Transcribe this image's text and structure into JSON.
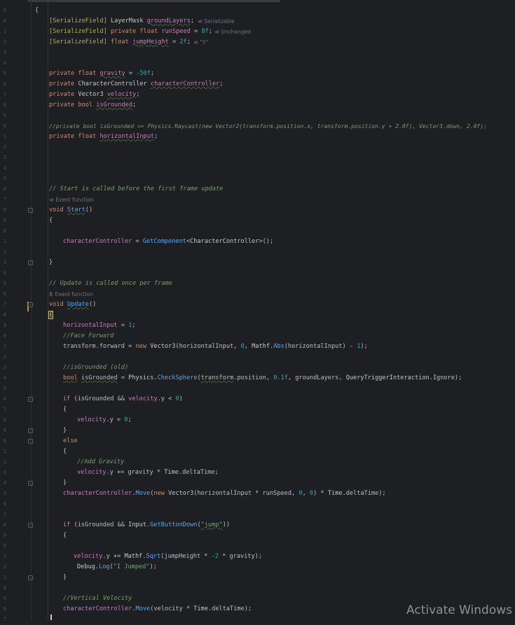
{
  "editor": {
    "gutter_numbers": [
      "9",
      "0",
      "1",
      "2",
      "3",
      "4",
      "5",
      "6",
      "7",
      "8",
      "9",
      "0",
      "1",
      "2",
      "3",
      "4",
      "5",
      "6",
      "7",
      "8",
      "9",
      "0",
      "1",
      "2",
      "3",
      "4",
      "5",
      "6",
      "7",
      "8",
      "9",
      "0",
      "1",
      "2",
      "3",
      "4",
      "5",
      "6",
      "7",
      "8",
      "9",
      "0",
      "1",
      "2",
      "3",
      "4",
      "5",
      "6",
      "7",
      "8",
      "9",
      "0",
      "1",
      "2",
      "3",
      "4",
      "5",
      "6",
      "7"
    ],
    "code": {
      "l1_brace": "{",
      "l2_attr": "[SerializeField]",
      "l2_type": "LayerMask",
      "l2_name": "groundLayers",
      "l2_end": ";",
      "l2_hint": "Serializable",
      "l3_attr": "[SerializeField]",
      "l3_kw": "private float",
      "l3_name": "runSpeed",
      "l3_eq": " = ",
      "l3_val": "8f",
      "l3_end": ";",
      "l3_hint": "Unchanged",
      "l4_attr": "[SerializeField]",
      "l4_kw": "float",
      "l4_name": "jumpHeight",
      "l4_eq": " = ",
      "l4_val": "2f",
      "l4_end": ";",
      "l4_hint": "\"5\"",
      "l7_kw": "private float",
      "l7_name": "gravity",
      "l7_eq": " = ",
      "l7_val": "-50f",
      "l7_end": ";",
      "l8_kw": "private",
      "l8_type": "CharacterController",
      "l8_name": "characterController",
      "l8_end": ";",
      "l9_kw": "private",
      "l9_type": "Vector3",
      "l9_name": "velocity",
      "l9_end": ";",
      "l10_kw": "private bool",
      "l10_name": "isGrounded",
      "l10_end": ";",
      "l12_comment": "//private bool isGrounded => Physics.Raycast(new Vector2(transform.position.x, transform.position.y + 2.0f), Vector3.down, 2.0f);",
      "l13_kw": "private float",
      "l13_name": "horizontalInput",
      "l13_end": ";",
      "l18_comment": "// Start is called before the first frame update",
      "hint_event_1": "Event function",
      "l19_kw": "void",
      "l19_name": "Start",
      "l19_end": "()",
      "l20_brace": "{",
      "l22_field": "characterController",
      "l22_eq": " = ",
      "l22_fn": "GetComponent",
      "l22_gen_open": "<",
      "l22_type": "CharacterController",
      "l22_gen_close": ">",
      "l22_end": "();",
      "l24_brace": "}",
      "l26_comment": "// Update is called once per frame",
      "hint_event_2": "Event function",
      "l27_kw": "void",
      "l27_name": "Update",
      "l27_end": "()",
      "l28_brace": "{",
      "l29_field": "horizontalInput",
      "l29_eq": " = ",
      "l29_val": "1",
      "l29_end": ";",
      "l30_comment": "//Face Forward",
      "l31_a": "transform.forward",
      "l31_b": " = ",
      "l31_kw": "new",
      "l31_type": "Vector3",
      "l31_c": "(horizontalInput, ",
      "l31_n": "0",
      "l31_d": ", ",
      "l31_e": "Mathf",
      "l31_f": ".",
      "l31_fn": "Abs",
      "l31_g": "(horizontalInput) - ",
      "l31_n2": "1",
      "l31_h": ");",
      "l33_comment": "//isGrounded (old)",
      "l34_kw": "bool",
      "l34_name": "isGrounded",
      "l34_a": " = ",
      "l34_type": "Physics",
      "l34_b": ".",
      "l34_fn": "CheckSphere",
      "l34_c": "(",
      "l34_d": "transform",
      "l34_e": ".position, ",
      "l34_n": "0.1f",
      "l34_f": ", groundLayers, ",
      "l34_type2": "QueryTriggerInteraction",
      "l34_g": ".Ignore);",
      "l36_kw": "if",
      "l36_a": " (isGrounded && ",
      "l36_b": "velocity",
      "l36_c": ".y < ",
      "l36_n": "0",
      "l36_d": ")",
      "l37_brace": "{",
      "l38_a": "velocity",
      "l38_b": ".y = ",
      "l38_n": "0",
      "l38_c": ";",
      "l39_brace": "}",
      "l40_kw": "else",
      "l41_brace": "{",
      "l42_comment": "//Add Gravity",
      "l43_a": "velocity",
      "l43_b": ".y += gravity * ",
      "l43_type": "Time",
      "l43_c": ".deltaTime;",
      "l44_brace": "}",
      "l45_a": "characterController",
      "l45_b": ".",
      "l45_fn": "Move",
      "l45_c": "(",
      "l45_kw": "new",
      "l45_type": "Vector3",
      "l45_d": "(horizontalInput * runSpeed, ",
      "l45_n1": "0",
      "l45_e": ", ",
      "l45_n2": "0",
      "l45_f": ") * ",
      "l45_type2": "Time",
      "l45_g": ".deltaTime);",
      "l48_kw": "if",
      "l48_a": " (isGrounded && ",
      "l48_type": "Input",
      "l48_b": ".",
      "l48_fn": "GetButtonDown",
      "l48_c": "(",
      "l48_str": "\"jump\"",
      "l48_d": "))",
      "l49_brace": "{",
      "l51_a": "velocity",
      "l51_b": ".y += ",
      "l51_type": "Mathf",
      "l51_c": ".",
      "l51_fn": "Sqrt",
      "l51_d": "(jumpHeight * ",
      "l51_n": "-2",
      "l51_e": " * gravity);",
      "l52_type": "Debug",
      "l52_a": ".",
      "l52_fn": "Log",
      "l52_b": "(",
      "l52_str": "\"I Jumped\"",
      "l52_c": ");",
      "l53_brace": "}",
      "l55_comment": "//Vertical Velocity",
      "l56_a": "characterController",
      "l56_b": ".",
      "l56_fn": "Move",
      "l56_c": "(velocity * ",
      "l56_type": "Time",
      "l56_d": ".deltaTime);"
    }
  },
  "watermark": "Activate Windows",
  "colors": {
    "background": "#1e1f22",
    "keyword": "#cf8e6d",
    "function": "#57aaf7",
    "number": "#2aacb8",
    "string": "#6aab73",
    "comment": "#7a9e6c",
    "attribute": "#b3ae60"
  }
}
